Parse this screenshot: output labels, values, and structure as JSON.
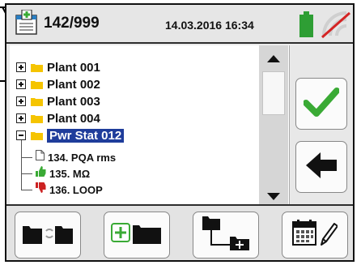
{
  "header": {
    "record_count": "142/999",
    "datetime": "14.03.2016 16:34",
    "icons": [
      "database-icon",
      "battery-icon",
      "signal-off-icon"
    ]
  },
  "tree": {
    "nodes": [
      {
        "label": "Plant 001",
        "state": "collapsed"
      },
      {
        "label": "Plant 002",
        "state": "collapsed"
      },
      {
        "label": "Plant 003",
        "state": "collapsed"
      },
      {
        "label": "Plant 004",
        "state": "collapsed"
      },
      {
        "label": "Pwr Stat 012",
        "state": "expanded",
        "selected": true,
        "children": [
          {
            "label": "134. PQA rms",
            "icon": "document-icon"
          },
          {
            "label": "135. MΩ",
            "icon": "thumbs-up-icon"
          },
          {
            "label": "136. LOOP",
            "icon": "thumbs-down-icon"
          }
        ]
      }
    ]
  },
  "side_buttons": [
    "confirm-icon",
    "back-arrow-icon"
  ],
  "bottom_buttons": [
    "move-folder-icon",
    "new-folder-icon",
    "new-subfolder-icon",
    "edit-calendar-icon"
  ],
  "colors": {
    "selection": "#1f3d9b",
    "folder": "#f5c400",
    "confirm": "#3aaa35",
    "thumb_up": "#3aaa35",
    "thumb_down": "#cc2222",
    "battery": "#2e9e34"
  }
}
